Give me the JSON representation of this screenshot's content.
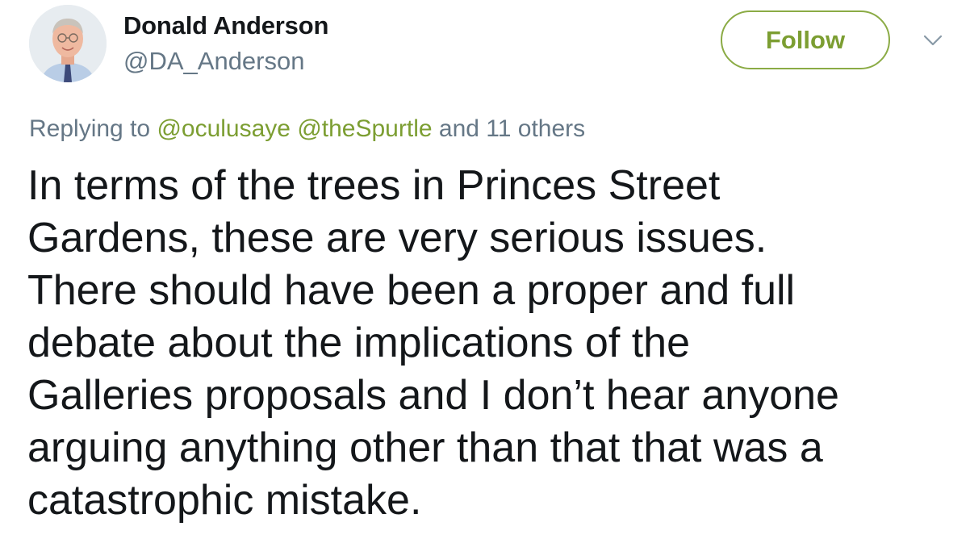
{
  "author": {
    "display_name": "Donald Anderson",
    "handle": "@DA_Anderson",
    "avatar_icon": "profile-photo"
  },
  "actions": {
    "follow_label": "Follow",
    "menu_icon": "chevron-down-icon"
  },
  "reply": {
    "prefix": "Replying to",
    "mentions": [
      "@oculusaye",
      "@theSpurtle"
    ],
    "others": "and 11 others"
  },
  "tweet": {
    "lines": [
      "In terms of the trees in Princes Street",
      "Gardens, these are very serious issues.",
      "There should have been a proper and full",
      "debate about the implications of the",
      "Galleries proposals and I don’t hear anyone",
      "arguing anything other than that that was a",
      "catastrophic mistake."
    ]
  },
  "colors": {
    "accent": "#7c9e32",
    "secondary_text": "#657786",
    "primary_text": "#14171a"
  }
}
